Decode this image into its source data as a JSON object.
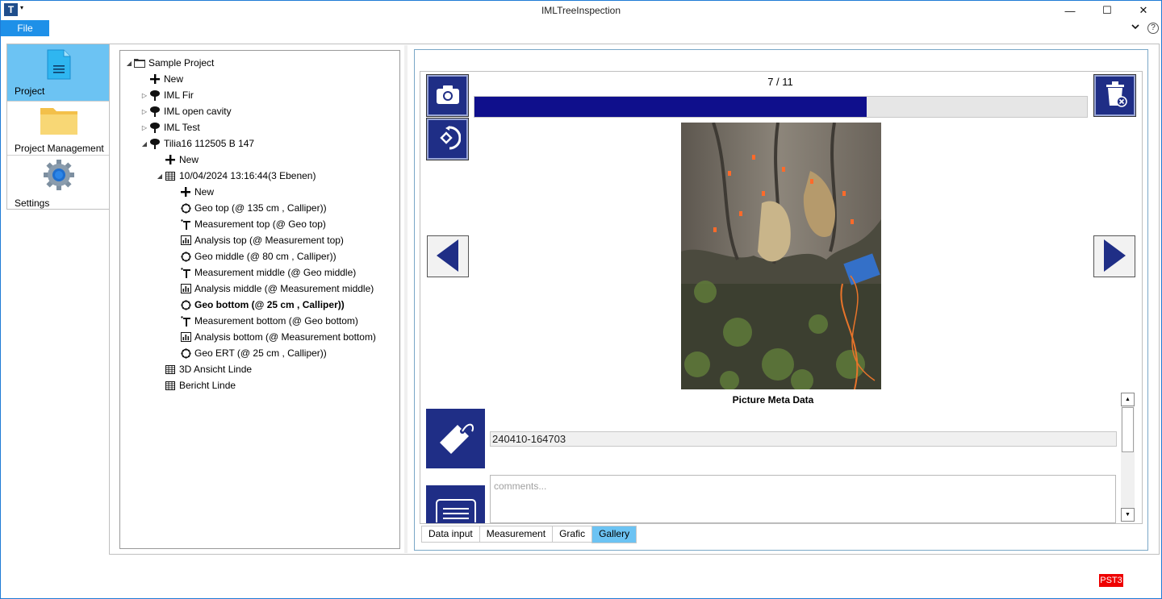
{
  "window": {
    "title": "IMLTreeInspection",
    "app_icon_letter": "T",
    "minimize": "—",
    "maximize": "☐",
    "close": "✕"
  },
  "menu": {
    "file": "File",
    "help": "?"
  },
  "nav": {
    "items": [
      {
        "label": "Project"
      },
      {
        "label": "Project Management"
      },
      {
        "label": "Settings"
      }
    ]
  },
  "tree": {
    "nodes": [
      {
        "label": "Sample Project",
        "icon": "folder-icon",
        "exp": "◢"
      },
      {
        "label": "New",
        "icon": "plus-icon",
        "exp": ""
      },
      {
        "label": "IML Fir",
        "icon": "tree-icon",
        "exp": "▷"
      },
      {
        "label": "IML open cavity",
        "icon": "tree-icon",
        "exp": "▷"
      },
      {
        "label": "IML Test",
        "icon": "tree-icon",
        "exp": "▷"
      },
      {
        "label": "Tilia16 112505 B 147",
        "icon": "tree-icon",
        "exp": "◢"
      },
      {
        "label": "New",
        "icon": "plus-icon",
        "exp": ""
      },
      {
        "label": "10/04/2024 13:16:44(3 Ebenen)",
        "icon": "table-icon",
        "exp": "◢"
      },
      {
        "label": "New",
        "icon": "plus-icon",
        "exp": ""
      },
      {
        "label": "Geo top (@ 135 cm , Calliper))",
        "icon": "geo-icon",
        "exp": ""
      },
      {
        "label": "Measurement top (@ Geo top)",
        "icon": "measure-icon",
        "exp": ""
      },
      {
        "label": "Analysis top (@ Measurement top)",
        "icon": "analysis-icon",
        "exp": ""
      },
      {
        "label": "Geo middle (@ 80 cm , Calliper))",
        "icon": "geo-icon",
        "exp": ""
      },
      {
        "label": "Measurement middle (@ Geo middle)",
        "icon": "measure-icon",
        "exp": ""
      },
      {
        "label": "Analysis middle (@ Measurement middle)",
        "icon": "analysis-icon",
        "exp": ""
      },
      {
        "label": "Geo bottom (@ 25 cm , Calliper))",
        "icon": "geo-icon",
        "exp": ""
      },
      {
        "label": "Measurement bottom (@ Geo bottom)",
        "icon": "measure-icon",
        "exp": ""
      },
      {
        "label": "Analysis bottom (@ Measurement bottom)",
        "icon": "analysis-icon",
        "exp": ""
      },
      {
        "label": "Geo ERT (@ 25 cm , Calliper))",
        "icon": "geo-icon",
        "exp": ""
      },
      {
        "label": "3D Ansicht Linde",
        "icon": "table-icon",
        "exp": ""
      },
      {
        "label": "Bericht Linde",
        "icon": "table-icon",
        "exp": ""
      }
    ]
  },
  "gallery": {
    "counter": "7 / 11",
    "progress": 0.64,
    "meta_title": "Picture Meta Data",
    "tag_value": "240410-164703",
    "comments_placeholder": "comments..."
  },
  "tabs": [
    {
      "label": "Data input"
    },
    {
      "label": "Measurement"
    },
    {
      "label": "Grafic"
    },
    {
      "label": "Gallery"
    }
  ],
  "status": {
    "badge": "PST3"
  },
  "colors": {
    "accent": "#1e90e8",
    "nav_active": "#6cc3f3",
    "button_blue": "#1f2e86",
    "progress": "#0f0f8c"
  }
}
